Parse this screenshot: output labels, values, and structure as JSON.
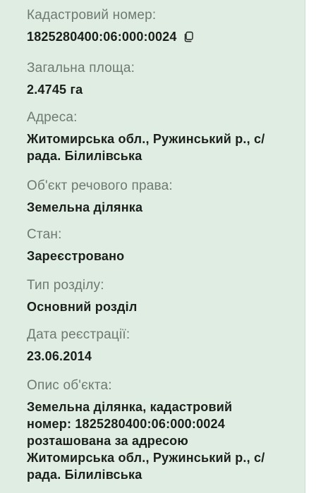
{
  "fields": {
    "cadastral": {
      "label": "Кадастровий номер:",
      "value": "1825280400:06:000:0024",
      "icon": "copy-icon"
    },
    "area": {
      "label": "Загальна площа:",
      "value": "2.4745 га"
    },
    "address": {
      "label": "Адреса:",
      "line1": "Житомирська обл., Ружинський р., с/",
      "line2": "рада. Білилівська"
    },
    "object": {
      "label": "Об'єкт речового права:",
      "value": "Земельна ділянка"
    },
    "status": {
      "label": "Стан:",
      "value": "Зареєстровано"
    },
    "section": {
      "label": "Тип розділу:",
      "value": "Основний розділ"
    },
    "date": {
      "label": "Дата реєстрації:",
      "value": "23.06.2014"
    },
    "description": {
      "label": "Опис об'єкта:",
      "line1": "Земельна ділянка, кадастровий",
      "line2": "номер: 1825280400:06:000:0024",
      "line3": "розташована за адресою",
      "line4": "Житомирська обл., Ружинський р., с/",
      "line5": "рада. Білилівська"
    }
  },
  "colors": {
    "card_background": "#e0ede3",
    "label_text": "#6e7a71",
    "value_text": "#1b1f1c"
  }
}
